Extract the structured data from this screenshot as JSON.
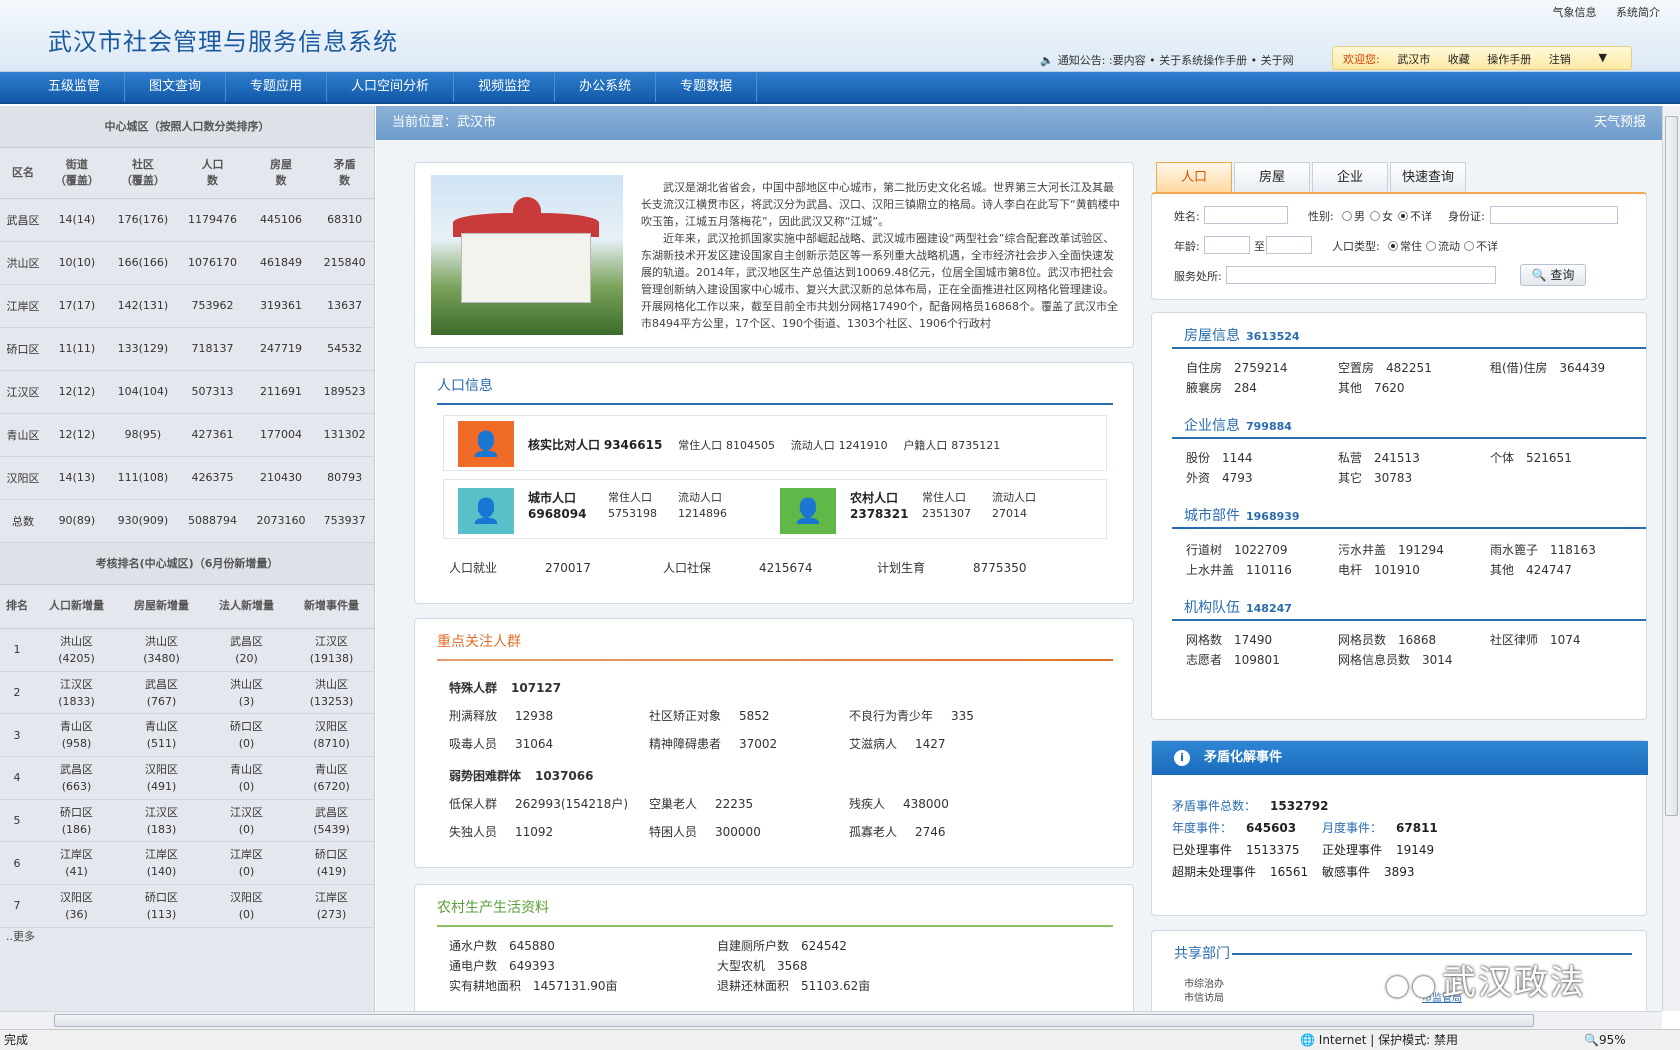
{
  "header": {
    "title": "武汉市社会管理与服务信息系统",
    "top_links": [
      "气象信息",
      "系统简介"
    ],
    "notice": "通知公告: :要内容   • 关于系统操作手册   • 关于网",
    "user_bar": {
      "welcome": "欢迎您:",
      "user": "武汉市",
      "links": [
        "收藏",
        "操作手册",
        "注销"
      ]
    }
  },
  "nav": [
    "五级监管",
    "图文查询",
    "专题应用",
    "人口空间分析",
    "视频监控",
    "办公系统",
    "专题数据"
  ],
  "left": {
    "district_title": "中心城区（按照人口数分类排序）",
    "district_headers": [
      "区名",
      "街道\n（覆盖）",
      "社区\n（覆盖）",
      "人口\n数",
      "房屋\n数",
      "矛盾\n数"
    ],
    "district_rows": [
      [
        "武昌区",
        "14(14)",
        "176(176)",
        "1179476",
        "445106",
        "68310"
      ],
      [
        "洪山区",
        "10(10)",
        "166(166)",
        "1076170",
        "461849",
        "215840"
      ],
      [
        "江岸区",
        "17(17)",
        "142(131)",
        "753962",
        "319361",
        "13637"
      ],
      [
        "硚口区",
        "11(11)",
        "133(129)",
        "718137",
        "247719",
        "54532"
      ],
      [
        "江汉区",
        "12(12)",
        "104(104)",
        "507313",
        "211691",
        "189523"
      ],
      [
        "青山区",
        "12(12)",
        "98(95)",
        "427361",
        "177004",
        "131302"
      ],
      [
        "汉阳区",
        "14(13)",
        "111(108)",
        "426375",
        "210430",
        "80793"
      ],
      [
        "总数",
        "90(89)",
        "930(909)",
        "5088794",
        "2073160",
        "753937"
      ]
    ],
    "rank_title": "考核排名(中心城区)（6月份新增量）",
    "rank_headers": [
      "排名",
      "人口新增量",
      "房屋新增量",
      "法人新增量",
      "新增事件量"
    ],
    "rank_rows": [
      [
        "1",
        "洪山区",
        "(4205)",
        "洪山区",
        "(3480)",
        "武昌区",
        "(20)",
        "江汉区",
        "(19138)"
      ],
      [
        "2",
        "江汉区",
        "(1833)",
        "武昌区",
        "(767)",
        "洪山区",
        "(3)",
        "洪山区",
        "(13253)"
      ],
      [
        "3",
        "青山区",
        "(958)",
        "青山区",
        "(511)",
        "硚口区",
        "(0)",
        "汉阳区",
        "(8710)"
      ],
      [
        "4",
        "武昌区",
        "(663)",
        "汉阳区",
        "(491)",
        "青山区",
        "(0)",
        "青山区",
        "(6720)"
      ],
      [
        "5",
        "硚口区",
        "(186)",
        "江汉区",
        "(183)",
        "江汉区",
        "(0)",
        "武昌区",
        "(5439)"
      ],
      [
        "6",
        "江岸区",
        "(41)",
        "江岸区",
        "(140)",
        "江岸区",
        "(0)",
        "硚口区",
        "(419)"
      ],
      [
        "7",
        "汉阳区",
        "(36)",
        "硚口区",
        "(113)",
        "汉阳区",
        "(0)",
        "江岸区",
        "(273)"
      ]
    ],
    "more": "..更多"
  },
  "location": {
    "label": "当前位置：武汉市",
    "weather": "天气预报"
  },
  "intro": {
    "p1": "武汉是湖北省省会，中国中部地区中心城市，第二批历史文化名城。世界第三大河长江及其最长支流汉江横贯市区，将武汉分为武昌、汉口、汉阳三镇鼎立的格局。诗人李白在此写下“黄鹤楼中吹玉笛，江城五月落梅花”，因此武汉又称“江城”。",
    "p2": "近年来，武汉抢抓国家实施中部崛起战略、武汉城市圈建设“两型社会”综合配套改革试验区、东湖新技术开发区建设国家自主创新示范区等一系列重大战略机遇，全市经济社会步入全面快速发展的轨道。2014年，武汉地区生产总值达到10069.48亿元，位居全国城市第8位。武汉市把社会管理创新纳入建设国家中心城市、复兴大武汉新的总体布局，正在全面推进社区网格化管理建设。开展网格化工作以来，截至目前全市共划分网格17490个，配备网格员16868个。覆盖了武汉市全市8494平方公里，17个区、190个街道、1303个社区、1906个行政村"
  },
  "population": {
    "title": "人口信息",
    "verify": {
      "label": "核实比对人口",
      "value": "9346615",
      "resident_label": "常住人口",
      "resident": "8104505",
      "floating_label": "流动人口",
      "floating": "1241910",
      "hukou_label": "户籍人口",
      "hukou": "8735121"
    },
    "urban": {
      "label": "城市人口",
      "value": "6968094",
      "resident_label": "常住人口",
      "resident": "5753198",
      "floating_label": "流动人口",
      "floating": "1214896"
    },
    "rural": {
      "label": "农村人口",
      "value": "2378321",
      "resident_label": "常住人口",
      "resident": "2351307",
      "floating_label": "流动人口",
      "floating": "27014"
    },
    "extra": [
      {
        "label": "人口就业",
        "value": "270017"
      },
      {
        "label": "人口社保",
        "value": "4215674"
      },
      {
        "label": "计划生育",
        "value": "8775350"
      }
    ]
  },
  "focus": {
    "title": "重点关注人群",
    "special": {
      "label": "特殊人群",
      "value": "107127"
    },
    "special_items": [
      {
        "label": "刑满释放",
        "value": "12938"
      },
      {
        "label": "社区矫正对象",
        "value": "5852"
      },
      {
        "label": "不良行为青少年",
        "value": "335"
      },
      {
        "label": "吸毒人员",
        "value": "31064"
      },
      {
        "label": "精神障碍患者",
        "value": "37002"
      },
      {
        "label": "艾滋病人",
        "value": "1427"
      }
    ],
    "weak": {
      "label": "弱势困难群体",
      "value": "1037066"
    },
    "weak_items": [
      {
        "label": "低保人群",
        "value": "262993(154218户)"
      },
      {
        "label": "空巢老人",
        "value": "22235"
      },
      {
        "label": "残疾人",
        "value": "438000"
      },
      {
        "label": "失独人员",
        "value": "11092"
      },
      {
        "label": "特困人员",
        "value": "300000"
      },
      {
        "label": "孤寡老人",
        "value": "2746"
      }
    ]
  },
  "rural_info": {
    "title": "农村生产生活资料",
    "items": [
      {
        "label": "通水户数",
        "value": "645880"
      },
      {
        "label": "自建厕所户数",
        "value": "624542"
      },
      {
        "label": "通电户数",
        "value": "649393"
      },
      {
        "label": "大型农机",
        "value": "3568"
      },
      {
        "label": "实有耕地面积",
        "value": "1457131.90亩"
      },
      {
        "label": "退耕还林面积",
        "value": "51103.62亩"
      }
    ]
  },
  "search": {
    "tabs": [
      "人口",
      "房屋",
      "企业",
      "快速查询"
    ],
    "name_label": "姓名:",
    "gender_label": "性别:",
    "gender_options": [
      "男",
      "女",
      "不详"
    ],
    "id_label": "身份证:",
    "age_label": "年龄:",
    "age_to": "至",
    "type_label": "人口类型:",
    "type_options": [
      "常住",
      "流动",
      "不详"
    ],
    "service_label": "服务处所:",
    "query_button": "查询"
  },
  "stats": {
    "housing": {
      "title": "房屋信息",
      "total": "3613524",
      "items": [
        {
          "label": "自住房",
          "value": "2759214"
        },
        {
          "label": "空置房",
          "value": "482251"
        },
        {
          "label": "租(借)住房",
          "value": "364439"
        },
        {
          "label": "腋襄房",
          "value": "284"
        },
        {
          "label": "其他",
          "value": "7620"
        }
      ]
    },
    "enterprise": {
      "title": "企业信息",
      "total": "799884",
      "items": [
        {
          "label": "股份",
          "value": "1144"
        },
        {
          "label": "私营",
          "value": "241513"
        },
        {
          "label": "个体",
          "value": "521651"
        },
        {
          "label": "外资",
          "value": "4793"
        },
        {
          "label": "其它",
          "value": "30783"
        }
      ]
    },
    "city_parts": {
      "title": "城市部件",
      "total": "1968939",
      "items": [
        {
          "label": "行道树",
          "value": "1022709"
        },
        {
          "label": "污水井盖",
          "value": "191294"
        },
        {
          "label": "雨水篦子",
          "value": "118163"
        },
        {
          "label": "上水井盖",
          "value": "110116"
        },
        {
          "label": "电杆",
          "value": "101910"
        },
        {
          "label": "其他",
          "value": "424747"
        }
      ]
    },
    "teams": {
      "title": "机构队伍",
      "total": "148247",
      "items": [
        {
          "label": "网格数",
          "value": "17490"
        },
        {
          "label": "网格员数",
          "value": "16868"
        },
        {
          "label": "社区律师",
          "value": "1074"
        },
        {
          "label": "志愿者",
          "value": "109801"
        },
        {
          "label": "网格信息员数",
          "value": "3014"
        }
      ]
    }
  },
  "conflict": {
    "title": "矛盾化解事件",
    "total_label": "矛盾事件总数：",
    "total": "1532792",
    "year_label": "年度事件：",
    "year": "645603",
    "month_label": "月度事件：",
    "month": "67811",
    "done_label": "已处理事件",
    "done": "1513375",
    "doing_label": "正处理事件",
    "doing": "19149",
    "overdue_label": "超期未处理事件",
    "overdue": "16561",
    "sensitive_label": "敏感事件",
    "sensitive": "3893"
  },
  "shared": {
    "title": "共享部门",
    "items": [
      "市综治办",
      "市信访局"
    ],
    "right_link": "市监管局"
  },
  "watermark": "武汉政法",
  "statusbar": {
    "left": "完成",
    "zone": "Internet | 保护模式: 禁用",
    "zoom": "95%"
  }
}
